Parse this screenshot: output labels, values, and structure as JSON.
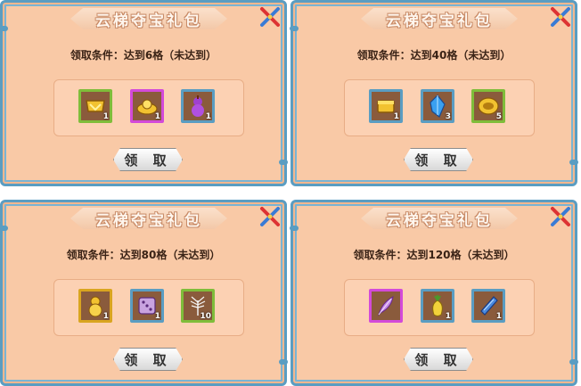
{
  "panels": [
    {
      "title": "云梯夺宝礼包",
      "condition": "领取条件：达到6格（未达到）",
      "button_label": "领 取",
      "items": [
        {
          "icon": "gold-chest-icon",
          "count": "1",
          "border": "#7fbd3a"
        },
        {
          "icon": "gold-ingot-icon",
          "count": "1",
          "border": "#d34ad9"
        },
        {
          "icon": "purple-gourd-icon",
          "count": "1",
          "border": "#5a9dc2"
        }
      ]
    },
    {
      "title": "云梯夺宝礼包",
      "condition": "领取条件：达到40格（未达到）",
      "button_label": "领 取",
      "items": [
        {
          "icon": "gold-chest-icon",
          "count": "1",
          "border": "#5a9dc2"
        },
        {
          "icon": "blue-crystal-icon",
          "count": "3",
          "border": "#5a9dc2"
        },
        {
          "icon": "gold-coil-icon",
          "count": "5",
          "border": "#7fbd3a"
        }
      ]
    },
    {
      "title": "云梯夺宝礼包",
      "condition": "领取条件：达到80格（未达到）",
      "button_label": "领 取",
      "items": [
        {
          "icon": "gold-gourd-icon",
          "count": "1",
          "border": "#d9a520"
        },
        {
          "icon": "dice-icon",
          "count": "1",
          "border": "#5a9dc2"
        },
        {
          "icon": "white-feather-icon",
          "count": "10",
          "border": "#7fbd3a"
        }
      ]
    },
    {
      "title": "云梯夺宝礼包",
      "condition": "领取条件：达到120格（未达到）",
      "button_label": "领 取",
      "items": [
        {
          "icon": "purple-feather-icon",
          "count": "",
          "border": "#d34ad9"
        },
        {
          "icon": "golden-fruit-icon",
          "count": "1",
          "border": "#5a9dc2"
        },
        {
          "icon": "blue-scroll-icon",
          "count": "1",
          "border": "#5a9dc2"
        }
      ]
    }
  ]
}
